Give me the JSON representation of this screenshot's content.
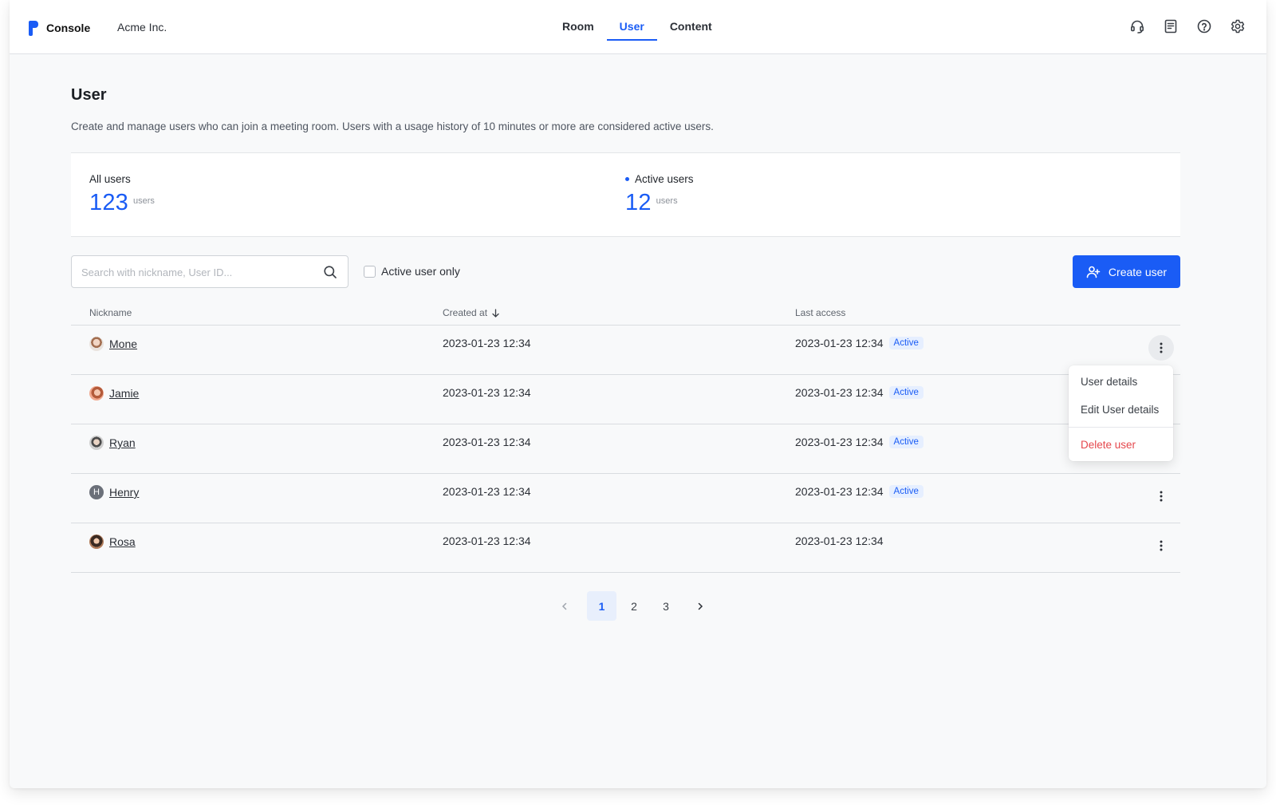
{
  "header": {
    "brand": "Console",
    "org": "Acme Inc.",
    "nav": [
      {
        "label": "Room",
        "active": false
      },
      {
        "label": "User",
        "active": true
      },
      {
        "label": "Content",
        "active": false
      }
    ],
    "icons": [
      "headset-icon",
      "document-icon",
      "help-icon",
      "settings-icon"
    ]
  },
  "page": {
    "title": "User",
    "description": "Create and manage users who can join a meeting room. Users with a usage history of 10 minutes or more are considered active users."
  },
  "stats": {
    "all": {
      "label": "All users",
      "value": "123",
      "unit": "users"
    },
    "active": {
      "label": "Active users",
      "value": "12",
      "unit": "users"
    }
  },
  "toolbar": {
    "search_placeholder": "Search with nickname, User ID...",
    "search_value": "",
    "active_only_label": "Active user only",
    "active_only_checked": false,
    "create_label": "Create user"
  },
  "table": {
    "columns": {
      "nickname": "Nickname",
      "created": "Created at",
      "access": "Last access"
    },
    "rows": [
      {
        "nickname": "Mone",
        "avatar": "photo",
        "initial": "",
        "created": "2023-01-23 12:34",
        "access": "2023-01-23 12:34",
        "badge": "Active"
      },
      {
        "nickname": "Jamie",
        "avatar": "photo",
        "initial": "",
        "created": "2023-01-23 12:34",
        "access": "2023-01-23 12:34",
        "badge": "Active"
      },
      {
        "nickname": "Ryan",
        "avatar": "photo",
        "initial": "",
        "created": "2023-01-23 12:34",
        "access": "2023-01-23 12:34",
        "badge": "Active"
      },
      {
        "nickname": "Henry",
        "avatar": "initial",
        "initial": "H",
        "created": "2023-01-23 12:34",
        "access": "2023-01-23 12:34",
        "badge": "Active"
      },
      {
        "nickname": "Rosa",
        "avatar": "photo",
        "initial": "",
        "created": "2023-01-23 12:34",
        "access": "2023-01-23 12:34",
        "badge": ""
      }
    ]
  },
  "row_menu": {
    "items": [
      {
        "label": "User details"
      },
      {
        "label": "Edit User details"
      },
      {
        "label": "Delete user"
      }
    ]
  },
  "pagination": {
    "pages": [
      "1",
      "2",
      "3"
    ],
    "current": "1"
  },
  "colors": {
    "accent": "#1a5cf5",
    "danger": "#e5484d",
    "badge_bg": "#e6efff"
  }
}
